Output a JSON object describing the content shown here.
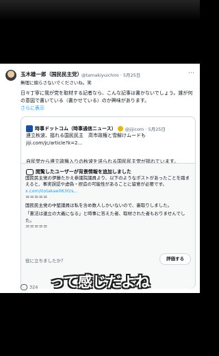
{
  "tweet": {
    "author_name": "玉木雄一郎（国民民主党）",
    "handle_date": "@tamakiyuichiro · 5月25日",
    "reply_line": "無理に煽らさないでくださいね。笑",
    "body": "日々丁寧に我が党を取材する記者なら、こんな記事は書かないでしょう。誰が何の意図で書いている（書かせている）のか興味があります。",
    "show_more": "さらに表示"
  },
  "quote": {
    "source": "時事ドットコム（時事通信ニュース）",
    "meta": "@jijicom · 5月25日",
    "line1": "連立秋波、揺れる国民民主　高市政権と雪解けムードも",
    "line2": "jiji.com/jc/article?k=2...",
    "summary": "自民党から連立政権入りの秋波を送られる国民民主党が揺れています。"
  },
  "note": {
    "title": "閲覧したユーザーが背景情報を追加しました",
    "para1": "国民民主党の伊藤たかえ参議院議員より、以下のようなポストがあったことを踏まえると、事実誤認や虚偽・捏造の可能性があることに留意が必要です。",
    "url": "x.com/itotakae0630/s...",
    "sep1": "＝＝＝＝＝",
    "para2": "国民民主党の中堅議員は私を含め数人しかいないので、裏取りしました。",
    "para3": "「憲法は連立の大義になる」と時事に答えた者、取材された者もおりませんでした。",
    "sep2": "＝＝＝＝＝"
  },
  "footer": {
    "helpful_prompt": "役に立ちましたか？",
    "rate_label": "評価する",
    "reply_count": "324"
  },
  "caption": "って感じだよね"
}
